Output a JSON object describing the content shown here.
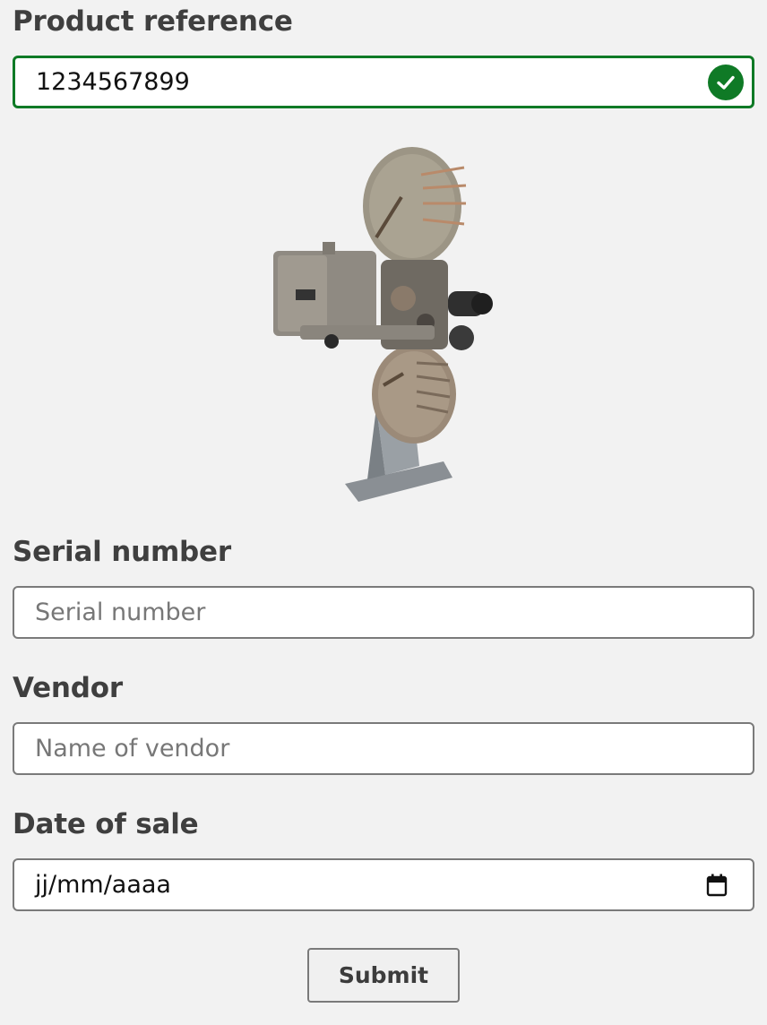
{
  "product_reference": {
    "label": "Product reference",
    "value": "1234567899",
    "status": "valid",
    "status_icon": "check-circle-icon",
    "status_color": "#0f7a26"
  },
  "product_image": {
    "icon": "film-projector-image"
  },
  "serial_number": {
    "label": "Serial number",
    "placeholder": "Serial number",
    "value": ""
  },
  "vendor": {
    "label": "Vendor",
    "placeholder": "Name of vendor",
    "value": ""
  },
  "date_of_sale": {
    "label": "Date of sale",
    "placeholder": "jj/mm/aaaa",
    "icon": "calendar-icon"
  },
  "submit": {
    "label": "Submit"
  }
}
